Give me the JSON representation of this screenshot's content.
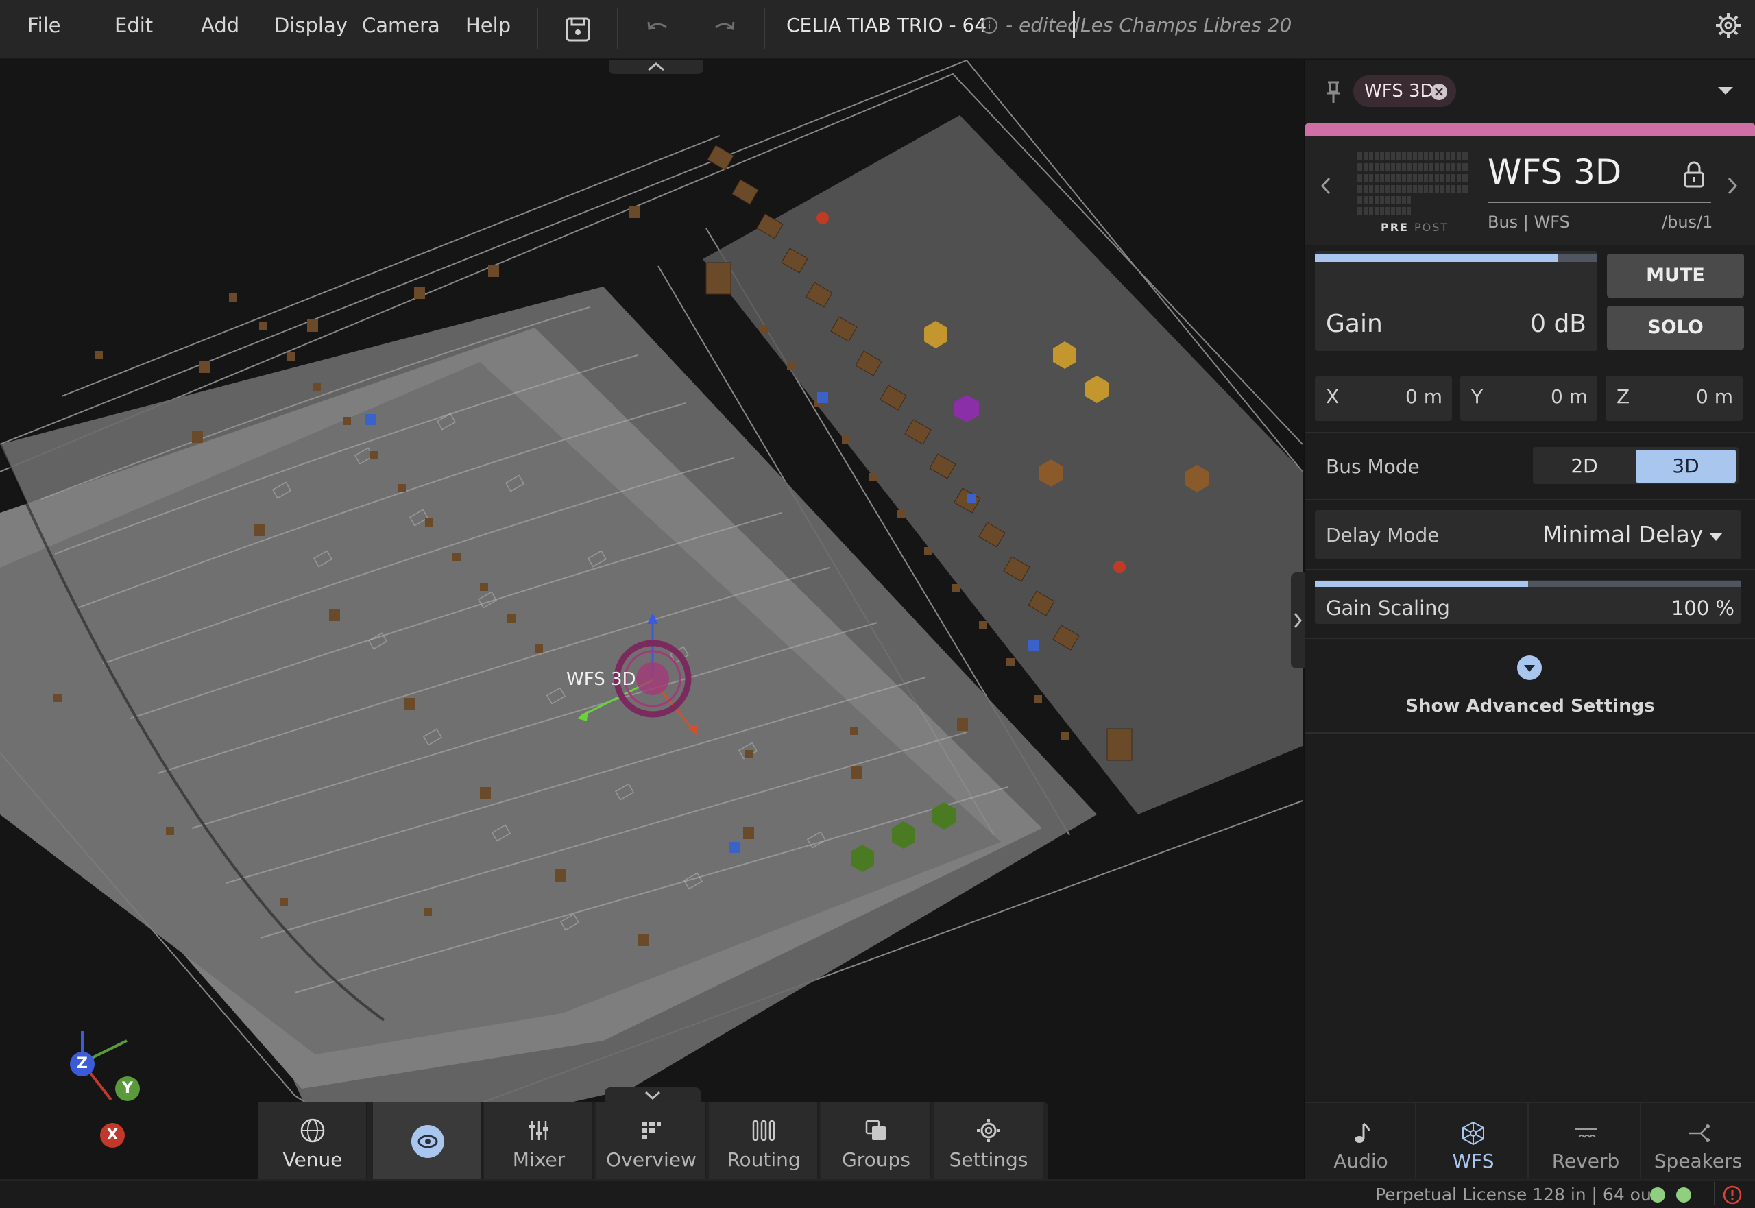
{
  "menu": {
    "file": "File",
    "edit": "Edit",
    "add": "Add",
    "display": "Display",
    "camera": "Camera",
    "help": "Help"
  },
  "title": {
    "project": "CELIA TIAB TRIO - 64",
    "edited": "- edited",
    "venue": "Les Champs Libres 20"
  },
  "viewport": {
    "selected_bus_label": "WFS 3D",
    "axes": {
      "x": "X",
      "y": "Y",
      "z": "Z"
    }
  },
  "dock": {
    "venue": "Venue",
    "mixer": "Mixer",
    "overview": "Overview",
    "routing": "Routing",
    "groups": "Groups",
    "settings": "Settings",
    "active": "view"
  },
  "panel": {
    "chip_label": "WFS 3D",
    "accent_color": "#d06fa6",
    "bus_name": "WFS 3D",
    "bus_type": "Bus | WFS",
    "bus_path": "/bus/1",
    "meter_pre": "PRE",
    "meter_post": "POST",
    "gain_label": "Gain",
    "gain_value": "0 dB",
    "gain_fill_fraction": 0.86,
    "mute": "MUTE",
    "solo": "SOLO",
    "x_label": "X",
    "x_value": "0 m",
    "y_label": "Y",
    "y_value": "0 m",
    "z_label": "Z",
    "z_value": "0 m",
    "bus_mode_label": "Bus Mode",
    "bus_mode_2d": "2D",
    "bus_mode_3d": "3D",
    "bus_mode_selected": "3D",
    "delay_mode_label": "Delay Mode",
    "delay_mode_value": "Minimal Delay",
    "gain_scaling_label": "Gain Scaling",
    "gain_scaling_value": "100 %",
    "gain_scaling_fraction": 0.5,
    "advanced_label": "Show Advanced Settings"
  },
  "tabs": {
    "audio": "Audio",
    "wfs": "WFS",
    "reverb": "Reverb",
    "speakers": "Speakers",
    "active": "WFS",
    "accent_color": "#a9c7ee"
  },
  "status": {
    "license": "Perpetual License 128 in | 64 out",
    "dot_color": "#8fcf7f"
  }
}
